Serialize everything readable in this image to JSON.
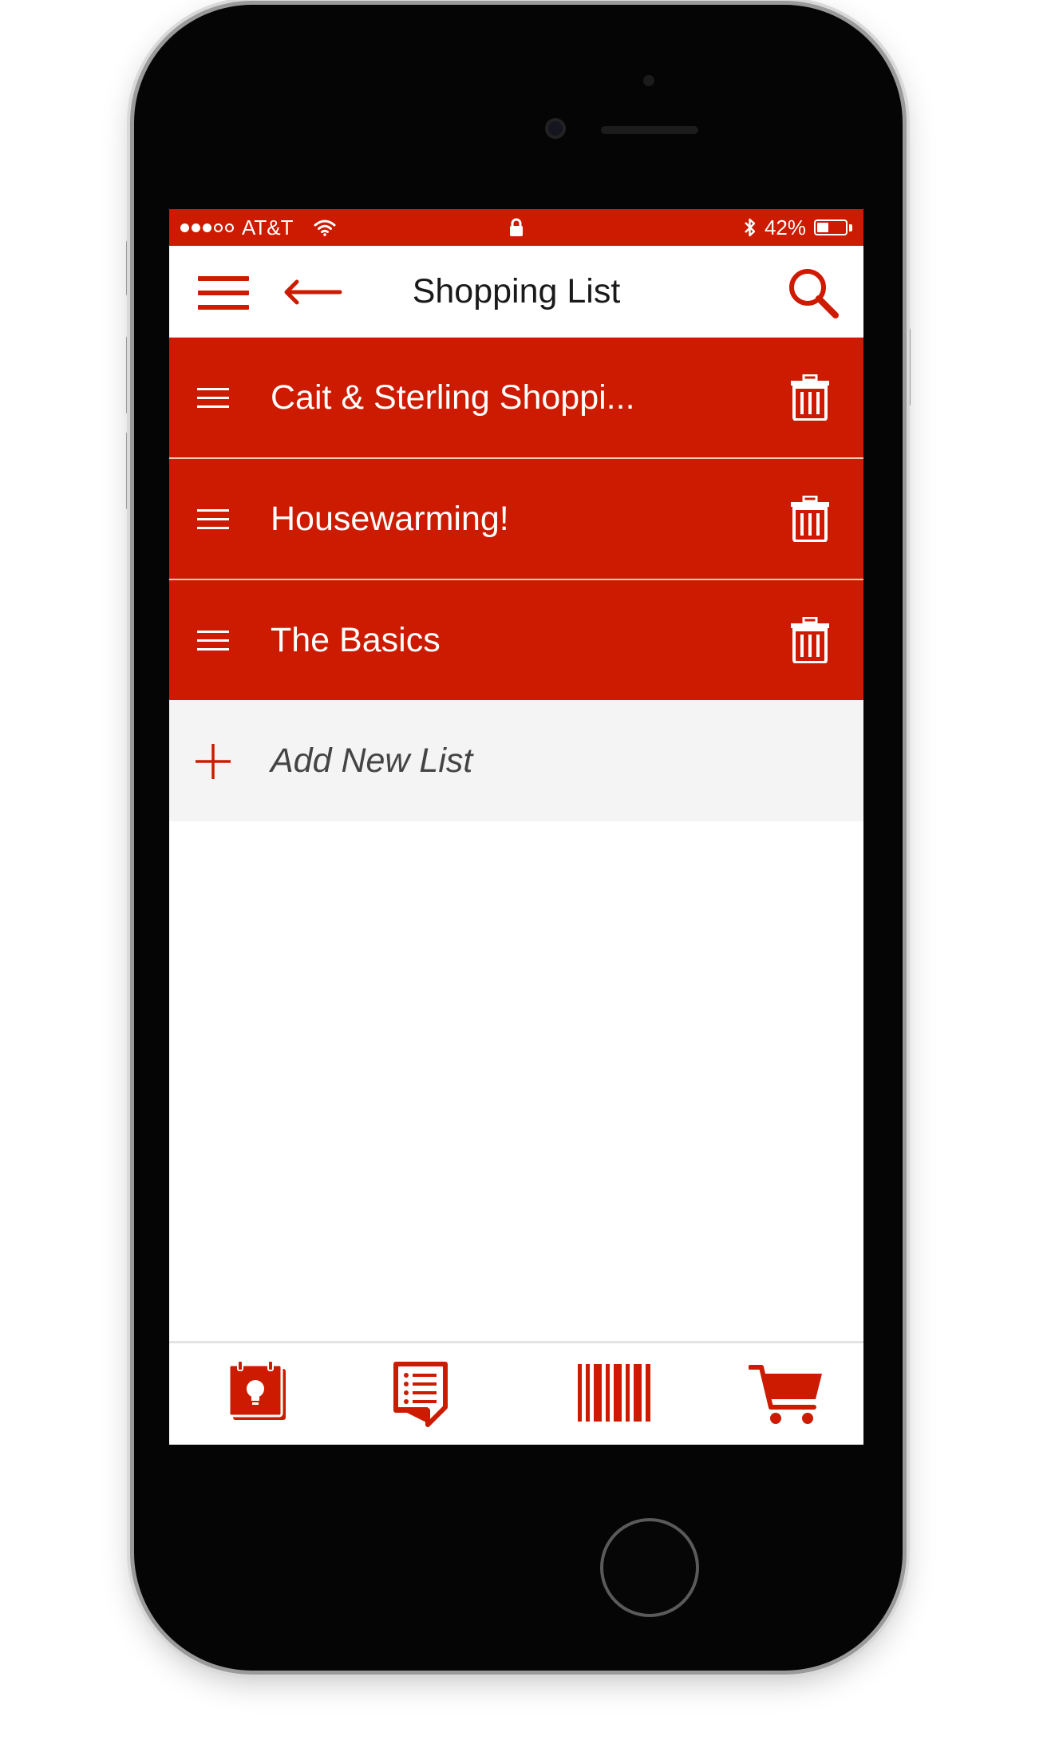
{
  "status_bar": {
    "carrier": "AT&T",
    "battery": "42%",
    "battery_level": 0.42,
    "signal_bars": 3,
    "signal_total": 5
  },
  "header": {
    "title": "Shopping List",
    "menu_icon": "hamburger-menu-icon",
    "back_icon": "back-arrow-icon",
    "search_icon": "search-icon"
  },
  "lists": [
    {
      "label": "Cait & Sterling Shoppi..."
    },
    {
      "label": "Housewarming!"
    },
    {
      "label": "The Basics"
    }
  ],
  "add_new": {
    "label": "Add New List"
  },
  "tab_bar": {
    "items": [
      {
        "icon": "weekly-ad-icon"
      },
      {
        "icon": "list-icon"
      },
      {
        "icon": "barcode-scan-icon"
      },
      {
        "icon": "cart-icon"
      }
    ]
  },
  "colors": {
    "brand_red": "#cc1b00",
    "header_bg": "#ffffff",
    "add_row_bg": "#f4f4f4"
  }
}
